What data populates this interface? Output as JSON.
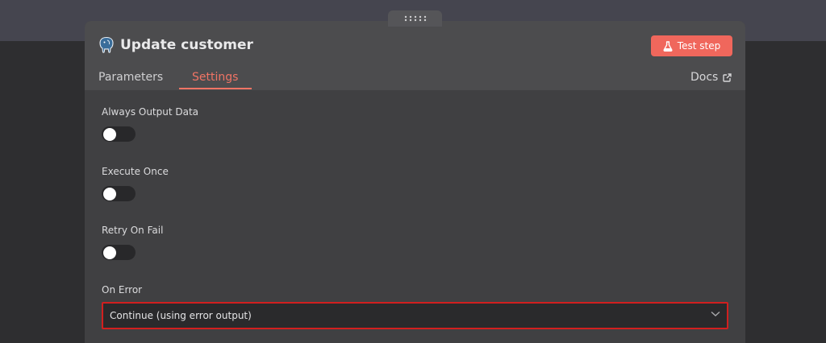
{
  "node": {
    "title": "Update customer",
    "icon": "postgres-elephant-icon"
  },
  "toolbar": {
    "test_step_label": "Test step"
  },
  "tabs": [
    {
      "label": "Parameters",
      "active": false
    },
    {
      "label": "Settings",
      "active": true
    }
  ],
  "docs": {
    "label": "Docs"
  },
  "settings": {
    "always_output_data": {
      "label": "Always Output Data",
      "enabled": false
    },
    "execute_once": {
      "label": "Execute Once",
      "enabled": false
    },
    "retry_on_fail": {
      "label": "Retry On Fail",
      "enabled": false
    },
    "on_error": {
      "label": "On Error",
      "value": "Continue (using error output)"
    }
  },
  "colors": {
    "accent": "#f0675c",
    "error_border": "#d21f1f",
    "panel_background": "#404042",
    "header_background": "#4c4c4e"
  }
}
